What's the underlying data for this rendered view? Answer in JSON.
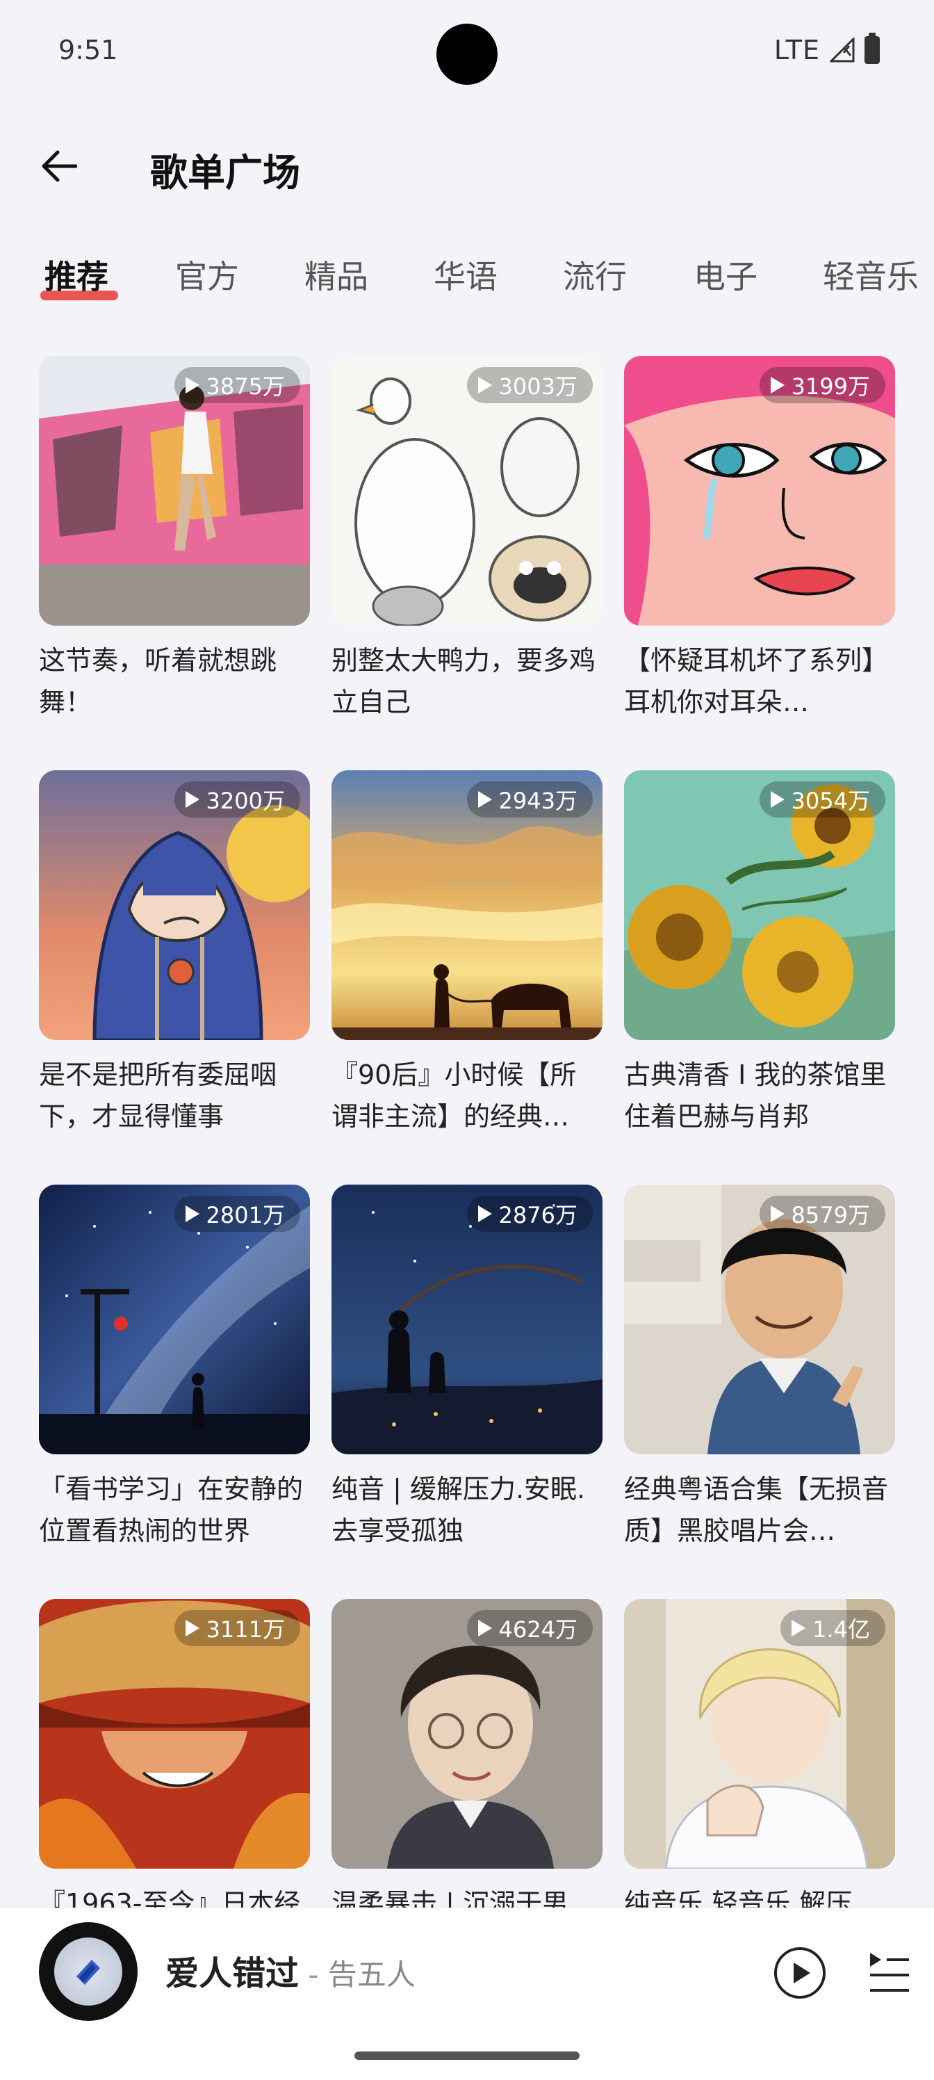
{
  "status_bar": {
    "time": "9:51",
    "network": "LTE"
  },
  "header": {
    "title": "歌单广场",
    "back_icon": "arrow-left-icon"
  },
  "tabs": [
    {
      "label": "推荐",
      "active": true
    },
    {
      "label": "官方",
      "active": false
    },
    {
      "label": "精品",
      "active": false
    },
    {
      "label": "华语",
      "active": false
    },
    {
      "label": "流行",
      "active": false
    },
    {
      "label": "电子",
      "active": false
    },
    {
      "label": "轻音乐",
      "active": false
    }
  ],
  "playlists": [
    {
      "plays": "3875万",
      "title": "这节奏，听着就想跳舞！"
    },
    {
      "plays": "3003万",
      "title": "别整太大鸭力，要多鸡立自己"
    },
    {
      "plays": "3199万",
      "title": "【怀疑耳机坏了系列】耳机你对耳朵…"
    },
    {
      "plays": "3200万",
      "title": "是不是把所有委屈咽下，才显得懂事"
    },
    {
      "plays": "2943万",
      "title": "『90后』小时候【所谓非主流】的经典…"
    },
    {
      "plays": "3054万",
      "title": "古典清香 I 我的茶馆里住着巴赫与肖邦"
    },
    {
      "plays": "2801万",
      "title": "「看书学习」在安静的位置看热闹的世界"
    },
    {
      "plays": "2876万",
      "title": "纯音 | 缓解压力.安眠.去享受孤独"
    },
    {
      "plays": "8579万",
      "title": "经典粤语合集【无损音质】黑胶唱片会…"
    },
    {
      "plays": "3111万",
      "title": "『1963-至今』日本经"
    },
    {
      "plays": "4624万",
      "title": "温柔暴击 | 沉溺于男"
    },
    {
      "plays": "1.4亿",
      "title": "纯音乐 轻音乐 解压"
    }
  ],
  "player": {
    "song": "爱人错过",
    "separator": " - ",
    "artist": "告五人",
    "play_icon": "play-icon",
    "playlist_icon": "playlist-icon"
  },
  "colors": {
    "accent": "#e53935",
    "background": "#f4f4f8"
  }
}
